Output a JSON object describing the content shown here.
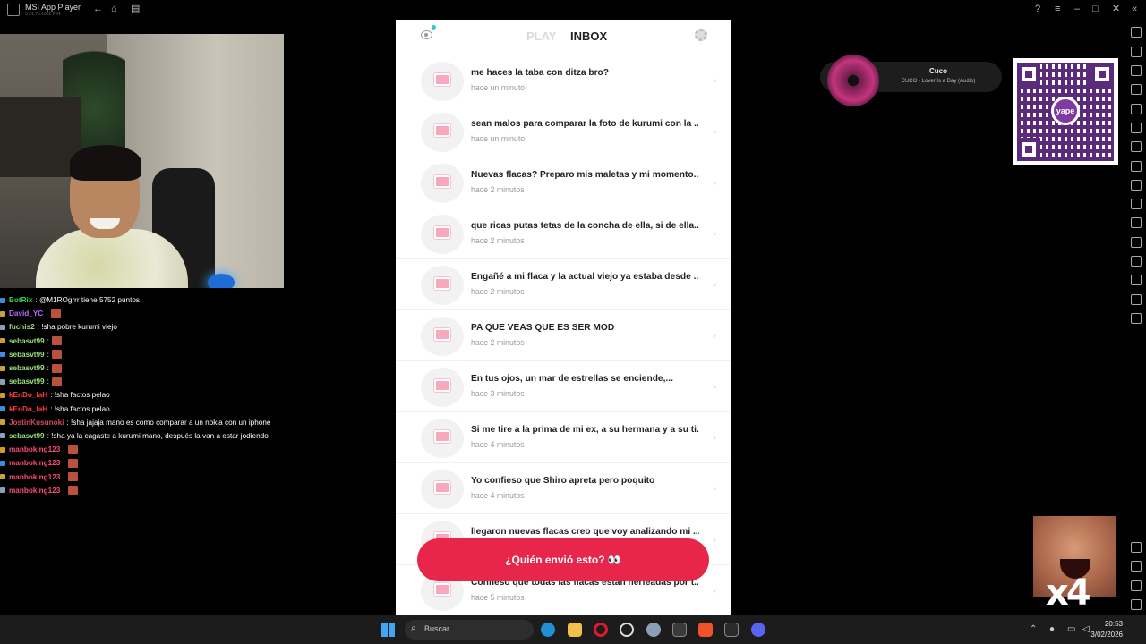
{
  "titlebar": {
    "app_title": "MSI App Player",
    "subtitle": "5.21.75.1002 P64"
  },
  "phone": {
    "tab_play": "PLAY",
    "tab_inbox": "INBOX",
    "messages": [
      {
        "title": "me haces la taba con ditza bro?",
        "time": "hace un minuto"
      },
      {
        "title": "sean malos para comparar la foto de kurumi con la ...",
        "time": "hace un minuto"
      },
      {
        "title": "Nuevas flacas? Preparo mis maletas y mi momento...",
        "time": "hace 2 minutos"
      },
      {
        "title": "que ricas putas tetas de la concha de ella, si de ella...",
        "time": "hace 2 minutos"
      },
      {
        "title": "Engañé a mi flaca y la actual viejo ya estaba desde ...",
        "time": "hace 2 minutos"
      },
      {
        "title": "PA QUE VEAS QUE ES SER MOD",
        "time": "hace 2 minutos"
      },
      {
        "title": "En tus ojos, un mar de estrellas se enciende,...",
        "time": "hace 3 minutos"
      },
      {
        "title": "Si me tire a la prima de mi ex, a su hermana y a su ti...",
        "time": "hace 4 minutos"
      },
      {
        "title": "Yo confieso que Shiro apreta pero poquito",
        "time": "hace 4 minutos"
      },
      {
        "title": "llegaron nuevas flacas creo que voy analizando mi ...",
        "time": "hace 5 minutos"
      },
      {
        "title": "Confieso que todas las flacas estan nerfeadas por t...",
        "time": "hace 5 minutos"
      }
    ],
    "cta_label": "¿Quién envió esto? 👀"
  },
  "chat": [
    {
      "user": "BotRix",
      "color": "#38d448",
      "text": ": @M1ROgrrr tiene 5752 puntos.",
      "emote": false
    },
    {
      "user": "David_YC",
      "color": "#b86cff",
      "text": ":",
      "emote": true
    },
    {
      "user": "fuchis2",
      "color": "#9be07a",
      "text": ": !sha pobre kurumi viejo",
      "emote": false
    },
    {
      "user": "sebasvt99",
      "color": "#9be07a",
      "text": ":",
      "emote": true
    },
    {
      "user": "sebasvt99",
      "color": "#9be07a",
      "text": ":",
      "emote": true
    },
    {
      "user": "sebasvt99",
      "color": "#9be07a",
      "text": ":",
      "emote": true
    },
    {
      "user": "sebasvt99",
      "color": "#9be07a",
      "text": ":",
      "emote": true
    },
    {
      "user": "kEnDo_laH",
      "color": "#ff3a3a",
      "text": ": !sha factos pelao",
      "emote": false
    },
    {
      "user": "kEnDo_laH",
      "color": "#ff3a3a",
      "text": ": !sha factos pelao",
      "emote": false
    },
    {
      "user": "JostinKusunoki",
      "color": "#d14a5a",
      "text": ": !sha jajaja mano es como comparar a un nokia con un iphone",
      "emote": false
    },
    {
      "user": "sebasvt99",
      "color": "#9be07a",
      "text": ": !sha ya la cagaste a kurumi mano, después la van a estar jodiendo",
      "emote": false
    },
    {
      "user": "manboking123",
      "color": "#ff4b7a",
      "text": ":",
      "emote": true
    },
    {
      "user": "manboking123",
      "color": "#ff4b7a",
      "text": ":",
      "emote": true
    },
    {
      "user": "manboking123",
      "color": "#ff4b7a",
      "text": ":",
      "emote": true
    },
    {
      "user": "manboking123",
      "color": "#ff4b7a",
      "text": ":",
      "emote": true
    }
  ],
  "music": {
    "song": "Cuco",
    "artist": "CUCO - Lover Is a Day (Audio)"
  },
  "qr": {
    "brand": "yape"
  },
  "overlay": {
    "text": "x4"
  },
  "taskbar": {
    "search_placeholder": "Buscar",
    "time": "20:53",
    "date": "3/02/2026"
  },
  "colors": {
    "accent": "#e8264c",
    "heart": "#f7a8bd",
    "inbox_active": "#222222",
    "play_inactive": "#d9d9d9"
  }
}
